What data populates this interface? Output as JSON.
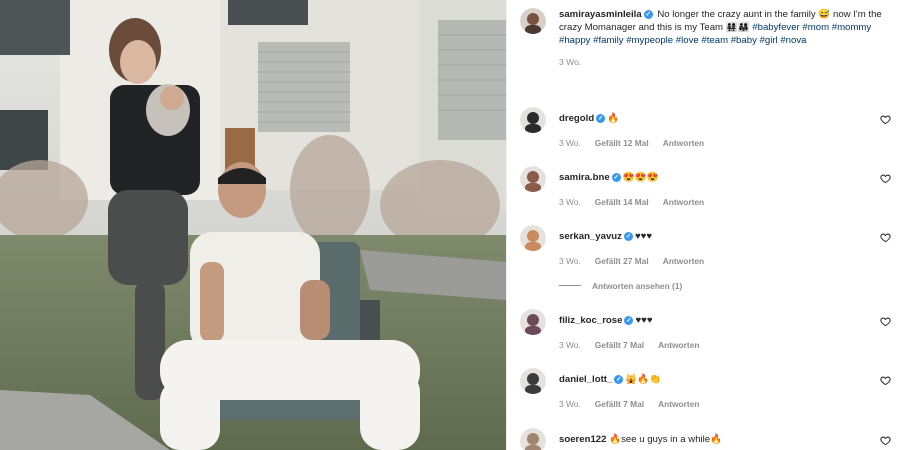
{
  "post": {
    "author": "samirayasminleila",
    "caption": "No longer the crazy aunt in the family 😅 now I'm the crazy Momanager and this is my Team 👨‍👩‍👧‍👧👨‍👩‍👧",
    "hashtags": "#babyfever #mom #mommy #happy #family #mypeople #love #team #baby #girl #nova",
    "age": "3 Wo."
  },
  "comments": [
    {
      "user": "dregold",
      "verified": true,
      "text": "🔥",
      "age": "3 Wo.",
      "likes": "Gefällt 12 Mal",
      "reply": "Antworten",
      "avatar_color": "#2b2b2b"
    },
    {
      "user": "samira.bne",
      "verified": true,
      "text": "😍😍😍",
      "age": "3 Wo.",
      "likes": "Gefällt 14 Mal",
      "reply": "Antworten",
      "avatar_color": "#8a5a4a"
    },
    {
      "user": "serkan_yavuz",
      "verified": true,
      "text": "♥♥♥",
      "age": "3 Wo.",
      "likes": "Gefällt 27 Mal",
      "reply": "Antworten",
      "avatar_color": "#c98b5e"
    },
    {
      "user": "filiz_koc_rose",
      "verified": true,
      "text": "♥♥♥",
      "age": "3 Wo.",
      "likes": "Gefällt 7 Mal",
      "reply": "Antworten",
      "avatar_color": "#6d4a58"
    },
    {
      "user": "daniel_lott_",
      "verified": true,
      "text": "🙀🔥👏",
      "age": "3 Wo.",
      "likes": "Gefällt 7 Mal",
      "reply": "Antworten",
      "avatar_color": "#3b3b3b"
    },
    {
      "user": "soeren122",
      "verified": false,
      "text": "🔥see u guys in a while🔥",
      "age": "",
      "likes": "",
      "reply": "",
      "avatar_color": "#a08670"
    }
  ],
  "view_replies": "Antworten ansehen (1)",
  "icons": {
    "verified": "verified-badge-icon",
    "like": "heart-outline-icon"
  },
  "colors": {
    "link": "#00376b",
    "verified": "#3897f0",
    "muted": "#8e8e8e"
  }
}
